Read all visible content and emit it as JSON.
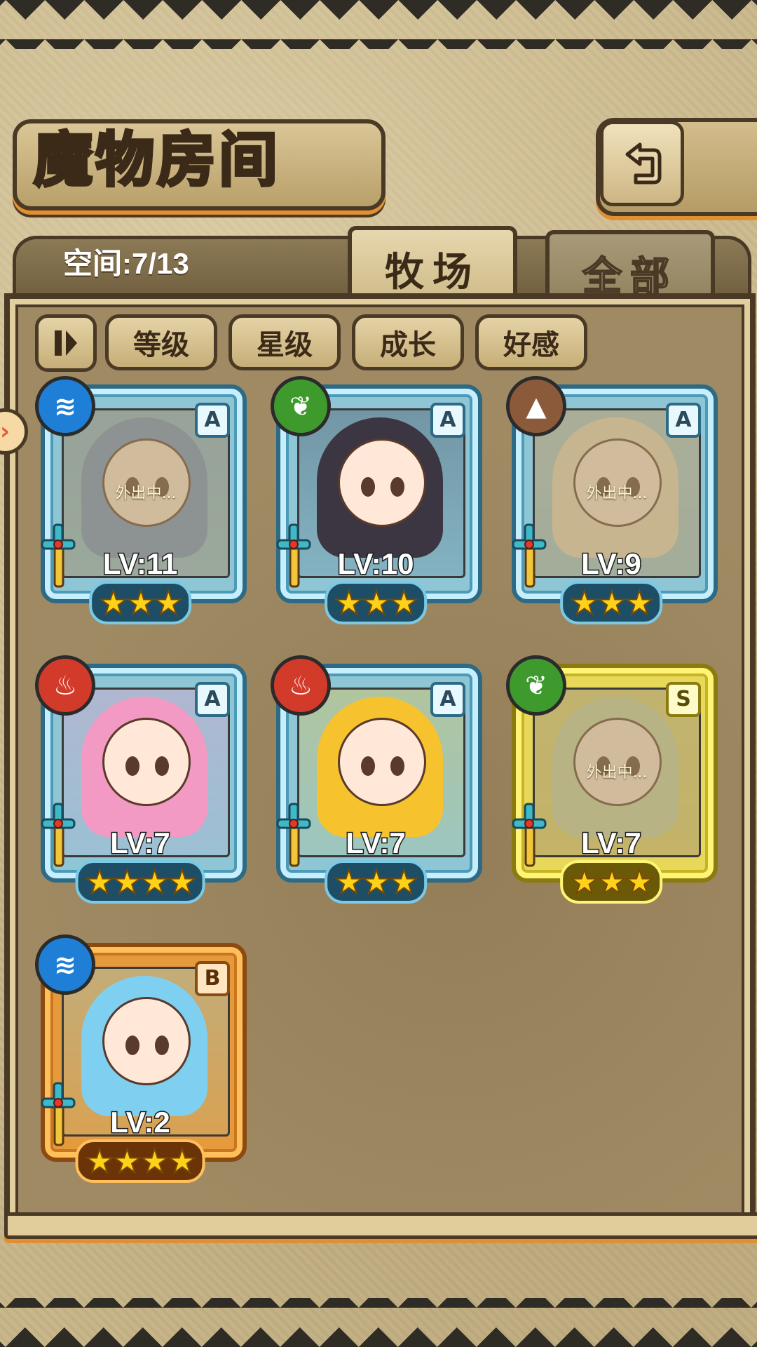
{
  "header": {
    "title": "魔物房间",
    "back_icon": "return-arrow-icon"
  },
  "storage": {
    "label": "空间:7/13"
  },
  "tabs": [
    {
      "label": "牧场",
      "active": true
    },
    {
      "label": "全部",
      "active": false
    }
  ],
  "filters": {
    "toggle_icon": "pause-bars-icon",
    "items": [
      "等级",
      "星级",
      "成长",
      "好感"
    ]
  },
  "monsters": [
    {
      "element": "water",
      "element_icon": "water-wave-icon",
      "element_color": "#1f7fd6",
      "rank": "A",
      "level": "LV:11",
      "stars": 3,
      "stars_text": "★★★",
      "away": "外出中...",
      "frame": "blue",
      "hair": "#6a8fbf"
    },
    {
      "element": "grass",
      "element_icon": "leaf-icon",
      "element_color": "#3f9a2e",
      "rank": "A",
      "level": "LV:10",
      "stars": 3,
      "stars_text": "★★★",
      "away": "",
      "frame": "blue",
      "hair": "#3b3642"
    },
    {
      "element": "earth",
      "element_icon": "mountain-icon",
      "element_color": "#8a5a3a",
      "rank": "A",
      "level": "LV:9",
      "stars": 3,
      "stars_text": "★★★",
      "away": "外出中...",
      "frame": "blue",
      "hair": "#e8dcb8"
    },
    {
      "element": "fire",
      "element_icon": "flame-icon",
      "element_color": "#d23a2a",
      "rank": "A",
      "level": "LV:7",
      "stars": 4,
      "stars_text": "★★★★",
      "away": "",
      "frame": "blue",
      "hair": "#f29ac4"
    },
    {
      "element": "fire",
      "element_icon": "flame-icon",
      "element_color": "#d23a2a",
      "rank": "A",
      "level": "LV:7",
      "stars": 3,
      "stars_text": "★★★",
      "away": "",
      "frame": "blue",
      "hair": "#f6c32e"
    },
    {
      "element": "grass",
      "element_icon": "leaf-icon",
      "element_color": "#3f9a2e",
      "rank": "S",
      "level": "LV:7",
      "stars": 3,
      "stars_text": "★★★",
      "away": "外出中...",
      "frame": "gold",
      "hair": "#c9d8a0"
    },
    {
      "element": "water",
      "element_icon": "water-wave-icon",
      "element_color": "#1f7fd6",
      "rank": "B",
      "level": "LV:2",
      "stars": 4,
      "stars_text": "★★★★",
      "away": "",
      "frame": "orange",
      "hair": "#7fd0f0"
    }
  ]
}
